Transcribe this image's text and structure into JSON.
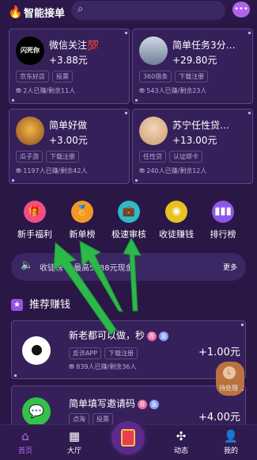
{
  "header": {
    "title": "智能接单"
  },
  "tasks": [
    {
      "name": "微信关注",
      "name_emoji": "💯",
      "price": "+3.88元",
      "tags": [
        "京东好店",
        "投票"
      ],
      "stat": "2人已赚/剩余11人",
      "avatar_text": "闪死你"
    },
    {
      "name": "简单任务3分…",
      "price": "+29.80元",
      "tags": [
        "360借条",
        "下载注册"
      ],
      "stat": "543人已赚/剩余23人"
    },
    {
      "name": "简单好做",
      "price": "+3.00元",
      "tags": [
        "瓜子游",
        "下载注册"
      ],
      "stat": "1197人已赚/剩余42人"
    },
    {
      "name": "苏宁任性贷…",
      "price": "+13.00元",
      "tags": [
        "任性贷",
        "认证绑卡"
      ],
      "stat": "240人已赚/剩余12人"
    }
  ],
  "shortcuts": [
    {
      "label": "新手福利",
      "icon": "gift-icon",
      "color": "#f24e86"
    },
    {
      "label": "新单榜",
      "icon": "medal-icon",
      "color": "#f09a25"
    },
    {
      "label": "极速审核",
      "icon": "briefcase-icon",
      "color": "#2fb9c8"
    },
    {
      "label": "收徒赚钱",
      "icon": "coin-icon",
      "color": "#e8c221"
    },
    {
      "label": "排行榜",
      "icon": "ranking-icon",
      "color": "#8a57e8"
    }
  ],
  "ticker": {
    "text": "收徒榜 金最高5688元现金",
    "more": "更多"
  },
  "section": {
    "title": "推荐赚钱"
  },
  "recommended": [
    {
      "name": "新老都可以做，秒",
      "tags": [
        "反诈APP",
        "下载注册"
      ],
      "stat": "839人已赚/剩余36人",
      "price": "+1.00元",
      "badges": [
        "荐",
        "急"
      ]
    },
    {
      "name": "简单填写邀请码",
      "tags": [
        "点淘",
        "投票"
      ],
      "stat": "",
      "price": "+4.00元",
      "badges": [
        "荐",
        "急"
      ]
    }
  ],
  "floating": {
    "label": "待处理"
  },
  "nav": [
    {
      "label": "首页",
      "icon": "home-icon",
      "active": true
    },
    {
      "label": "大厅",
      "icon": "grid-icon",
      "active": false
    },
    {
      "label": "",
      "icon": "red-envelope-icon",
      "active": false
    },
    {
      "label": "动态",
      "icon": "pinwheel-icon",
      "active": false
    },
    {
      "label": "我的",
      "icon": "user-icon",
      "active": false
    }
  ],
  "colors": {
    "background": "#2a1746",
    "card": "#36205a",
    "accent": "#9055e6",
    "arrow": "#2db84a"
  }
}
